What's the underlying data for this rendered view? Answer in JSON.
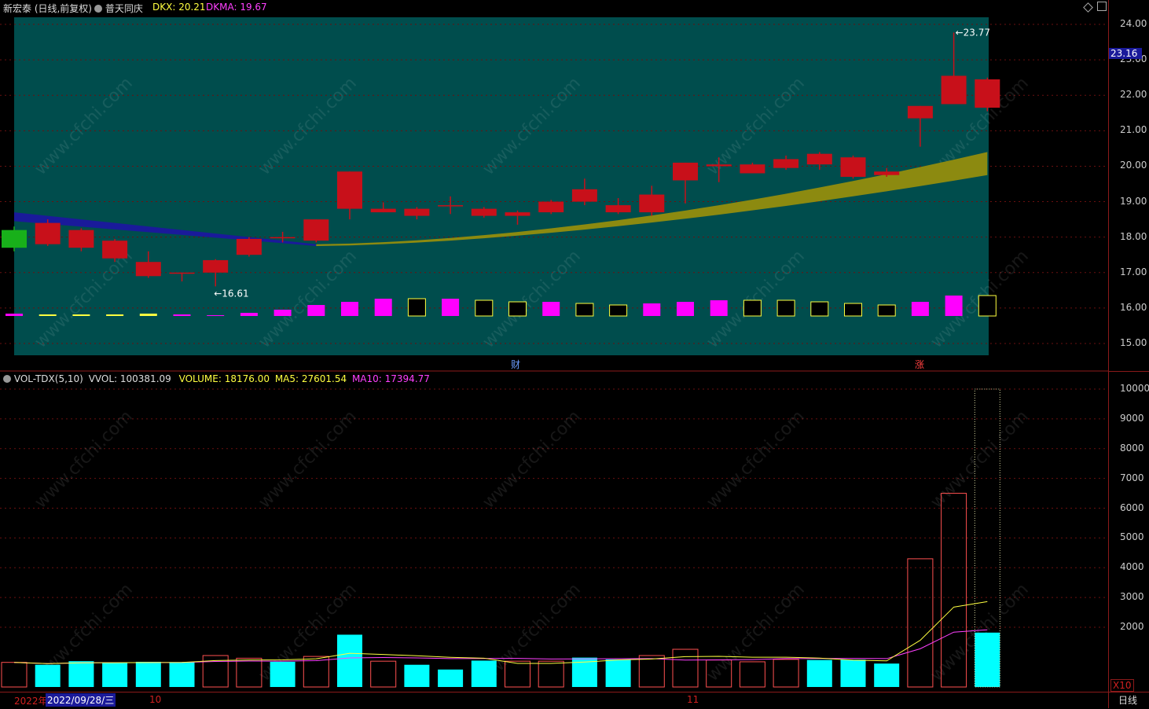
{
  "header": {
    "stock_title": "新宏泰 (日线,前复权)",
    "sector": "普天同庆",
    "dkx_label": "DKX: 20.21",
    "dkma_label": "DKMA: 19.67"
  },
  "volume_header": {
    "indicator": "VOL-TDX(5,10)",
    "vvol": "VVOL: 100381.09",
    "volume": "VOLUME: 18176.00",
    "ma5": "MA5: 27601.54",
    "ma10": "MA10: 17394.77"
  },
  "price_axis": {
    "ticks": [
      "24.00",
      "23.00",
      "22.00",
      "21.00",
      "20.00",
      "19.00",
      "18.00",
      "17.00",
      "16.00",
      "15.00"
    ],
    "current_price": "23.16"
  },
  "volume_axis": {
    "ticks": [
      "10000",
      "9000",
      "8000",
      "7000",
      "6000",
      "5000",
      "4000",
      "3000",
      "2000"
    ],
    "multiplier": "X10"
  },
  "annotations": {
    "high": "23.77",
    "low": "16.61",
    "event_cai": "财",
    "event_zhang": "涨"
  },
  "bottom_axis": {
    "year_label": "2022年",
    "cursor_date": "2022/09/28/三",
    "month_10": "10",
    "month_11": "11"
  },
  "period_button": "日线",
  "watermark": "www.cfchi.com",
  "colors": {
    "up": "#c8101a",
    "down": "#18b01a",
    "volume_up": "#ff5050",
    "volume_down": "#00ffff",
    "ma5": "#ffff40",
    "ma10": "#ff40ff",
    "panel_bg": "#004d4d",
    "dkx_band_low": "#1a1a9a",
    "dkx_band_high": "#8c8a10"
  },
  "chart_data": {
    "type": "candlestick",
    "candles": [
      {
        "open": 18.2,
        "close": 17.7,
        "high": 18.3,
        "low": 17.6
      },
      {
        "open": 17.8,
        "close": 18.4,
        "high": 18.5,
        "low": 17.75
      },
      {
        "open": 17.7,
        "close": 18.2,
        "high": 18.25,
        "low": 17.6
      },
      {
        "open": 17.4,
        "close": 17.9,
        "high": 17.95,
        "low": 17.3
      },
      {
        "open": 16.9,
        "close": 17.3,
        "high": 17.6,
        "low": 16.85
      },
      {
        "open": 17.0,
        "close": 17.0,
        "high": 17.0,
        "low": 16.75
      },
      {
        "open": 17.0,
        "close": 17.35,
        "high": 17.38,
        "low": 16.61
      },
      {
        "open": 17.5,
        "close": 17.95,
        "high": 18.0,
        "low": 17.45
      },
      {
        "open": 18.0,
        "close": 18.0,
        "high": 18.15,
        "low": 17.85
      },
      {
        "open": 17.9,
        "close": 18.5,
        "high": 18.5,
        "low": 17.85
      },
      {
        "open": 18.8,
        "close": 19.85,
        "high": 19.85,
        "low": 18.5
      },
      {
        "open": 18.7,
        "close": 18.8,
        "high": 18.98,
        "low": 18.7
      },
      {
        "open": 18.6,
        "close": 18.8,
        "high": 18.85,
        "low": 18.5
      },
      {
        "open": 18.9,
        "close": 18.9,
        "high": 19.15,
        "low": 18.65
      },
      {
        "open": 18.6,
        "close": 18.8,
        "high": 18.85,
        "low": 18.55
      },
      {
        "open": 18.6,
        "close": 18.7,
        "high": 18.75,
        "low": 18.35
      },
      {
        "open": 18.7,
        "close": 19.0,
        "high": 19.05,
        "low": 18.65
      },
      {
        "open": 19.0,
        "close": 19.35,
        "high": 19.65,
        "low": 18.9
      },
      {
        "open": 18.7,
        "close": 18.9,
        "high": 19.1,
        "low": 18.65
      },
      {
        "open": 18.7,
        "close": 19.2,
        "high": 19.45,
        "low": 18.6
      },
      {
        "open": 19.6,
        "close": 20.1,
        "high": 20.1,
        "low": 18.95
      },
      {
        "open": 20.0,
        "close": 20.05,
        "high": 20.25,
        "low": 19.55
      },
      {
        "open": 19.8,
        "close": 20.05,
        "high": 20.1,
        "low": 19.8
      },
      {
        "open": 19.95,
        "close": 20.2,
        "high": 20.3,
        "low": 19.9
      },
      {
        "open": 20.05,
        "close": 20.35,
        "high": 20.4,
        "low": 19.9
      },
      {
        "open": 19.7,
        "close": 20.25,
        "high": 20.3,
        "low": 19.65
      },
      {
        "open": 19.75,
        "close": 19.85,
        "high": 19.95,
        "low": 19.7
      },
      {
        "open": 21.35,
        "close": 21.7,
        "high": 21.7,
        "low": 20.55
      },
      {
        "open": 21.75,
        "close": 22.55,
        "high": 23.77,
        "low": 21.75
      },
      {
        "open": 21.65,
        "close": 22.45,
        "high": 22.5,
        "low": 21.55
      }
    ],
    "volume": [
      {
        "v": 820,
        "up": true
      },
      {
        "v": 740,
        "up": false
      },
      {
        "v": 860,
        "up": false
      },
      {
        "v": 820,
        "up": false
      },
      {
        "v": 840,
        "up": false
      },
      {
        "v": 830,
        "up": false
      },
      {
        "v": 1050,
        "up": true
      },
      {
        "v": 960,
        "up": true
      },
      {
        "v": 840,
        "up": false
      },
      {
        "v": 1020,
        "up": true
      },
      {
        "v": 1750,
        "up": false
      },
      {
        "v": 860,
        "up": true
      },
      {
        "v": 740,
        "up": false
      },
      {
        "v": 580,
        "up": false
      },
      {
        "v": 880,
        "up": false
      },
      {
        "v": 860,
        "up": true
      },
      {
        "v": 860,
        "up": true
      },
      {
        "v": 980,
        "up": false
      },
      {
        "v": 920,
        "up": false
      },
      {
        "v": 1050,
        "up": true
      },
      {
        "v": 1260,
        "up": true
      },
      {
        "v": 900,
        "up": true
      },
      {
        "v": 840,
        "up": true
      },
      {
        "v": 920,
        "up": true
      },
      {
        "v": 900,
        "up": false
      },
      {
        "v": 910,
        "up": false
      },
      {
        "v": 780,
        "up": false
      },
      {
        "v": 4300,
        "up": true
      },
      {
        "v": 6500,
        "up": true
      },
      {
        "v": 1820,
        "up": false
      }
    ]
  }
}
